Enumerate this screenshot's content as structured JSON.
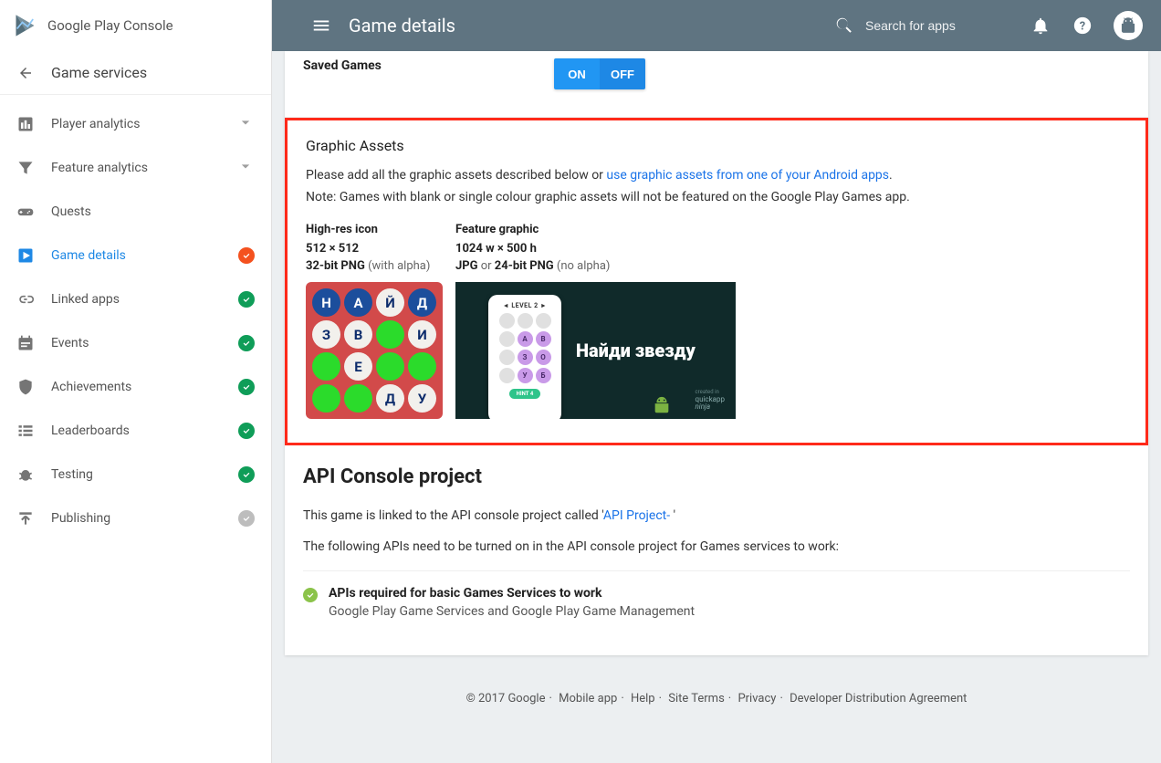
{
  "brand": "Google Play Console",
  "header": {
    "title": "Game details",
    "search_placeholder": "Search for apps"
  },
  "back_label": "Game services",
  "nav": {
    "player_analytics": "Player analytics",
    "feature_analytics": "Feature analytics",
    "quests": "Quests",
    "game_details": "Game details",
    "linked_apps": "Linked apps",
    "events": "Events",
    "achievements": "Achievements",
    "leaderboards": "Leaderboards",
    "testing": "Testing",
    "publishing": "Publishing"
  },
  "saved": {
    "label": "Saved Games",
    "on": "ON",
    "off": "OFF"
  },
  "graphic": {
    "heading": "Graphic Assets",
    "desc_prefix": "Please add all the graphic assets described below or ",
    "link": "use graphic assets from one of your Android apps",
    "desc_suffix": ".",
    "note": "Note: Games with blank or single colour graphic assets will not be featured on the Google Play Games app.",
    "icon": {
      "title": "High-res icon",
      "dims": "512 × 512",
      "fmt_bold": "32-bit PNG",
      "fmt_rest": " (with alpha)",
      "letters": [
        "Н",
        "А",
        "Й",
        "Д",
        "З",
        "В",
        "",
        "И",
        "",
        "Е",
        "",
        "",
        "",
        "",
        "Д",
        "У"
      ]
    },
    "feature": {
      "title": "Feature graphic",
      "dims": "1024 w × 500 h",
      "fmt1": "JPG",
      "or": " or ",
      "fmt2": "24-bit PNG",
      "fmt_rest": " (no alpha)",
      "level": "LEVEL 2",
      "grid": [
        "",
        "",
        "",
        "",
        "А",
        "В",
        "",
        "З",
        "О",
        "",
        "У",
        "Б"
      ],
      "hint": "HINT   4",
      "big": "Найди звезду",
      "credit1": "created in",
      "credit2": "quickapp",
      "credit3": "ninja"
    }
  },
  "api": {
    "heading": "API Console project",
    "linked_prefix": "This game is linked to the API console project called '",
    "linked_link": "API Project- ",
    "linked_suffix": "'",
    "note": "The following APIs need to be turned on in the API console project for Games services to work:",
    "req_title": "APIs required for basic Games Services to work",
    "req_desc": "Google Play Game Services and Google Play Game Management"
  },
  "footer": {
    "copyright": "© 2017 Google",
    "mobile": "Mobile app",
    "help": "Help",
    "terms": "Site Terms",
    "privacy": "Privacy",
    "dda": "Developer Distribution Agreement"
  }
}
